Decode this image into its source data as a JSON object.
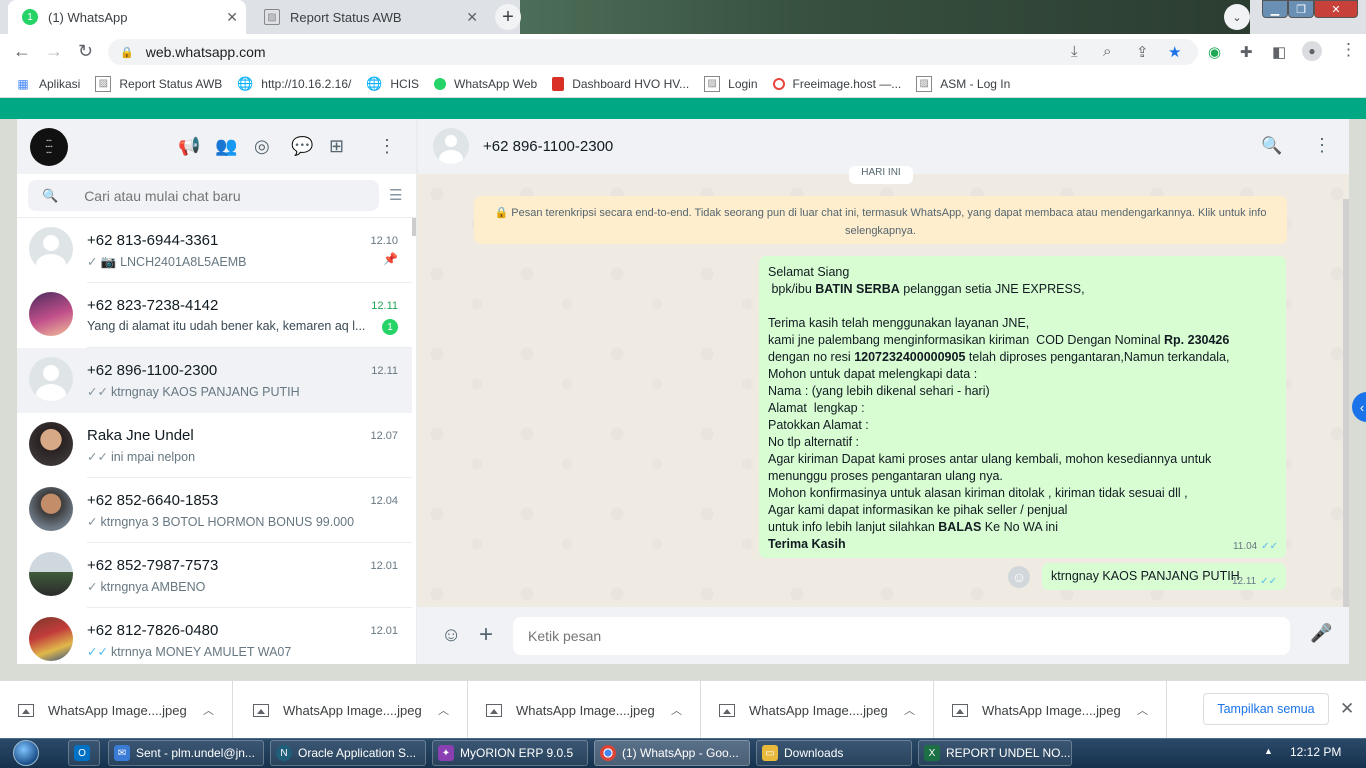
{
  "browser": {
    "tabs": [
      {
        "label": "(1) WhatsApp",
        "badge": "1"
      },
      {
        "label": "Report Status AWB"
      }
    ],
    "url": "web.whatsapp.com",
    "bookmarks": [
      {
        "label": "Aplikasi",
        "icon": "apps-grid-icon"
      },
      {
        "label": "Report Status AWB",
        "icon": "broken-image-icon"
      },
      {
        "label": "http://10.16.2.16/",
        "icon": "globe-icon"
      },
      {
        "label": "HCIS",
        "icon": "globe-icon"
      },
      {
        "label": "WhatsApp Web",
        "icon": "whatsapp-icon"
      },
      {
        "label": "Dashboard HVO HV...",
        "icon": "dashboard-icon"
      },
      {
        "label": "Login",
        "icon": "broken-image-icon"
      },
      {
        "label": "Freeimage.host —...",
        "icon": "freeimage-icon"
      },
      {
        "label": "ASM - Log In",
        "icon": "broken-image-icon"
      }
    ]
  },
  "sidebar": {
    "search_placeholder": "Cari atau mulai chat baru",
    "chats": [
      {
        "name": "+62 813-6944-3361",
        "time": "12.10",
        "preview": "LNCH2401A8L5AEMB",
        "tick": "✓",
        "tick_color": "grey",
        "photo_icon": true,
        "pinned": true
      },
      {
        "name": "+62 823-7238-4142",
        "time": "12.11",
        "preview": "Yang di alamat itu udah bener kak, kemaren aq l...",
        "unread": "1"
      },
      {
        "name": "+62 896-1100-2300",
        "time": "12.11",
        "preview": "ktrngnay KAOS PANJANG PUTIH",
        "tick": "✓✓",
        "tick_color": "grey",
        "active": true
      },
      {
        "name": "Raka Jne Undel",
        "time": "12.07",
        "preview": "ini mpai nelpon",
        "tick": "✓✓",
        "tick_color": "grey"
      },
      {
        "name": "+62 852-6640-1853",
        "time": "12.04",
        "preview": "ktrngnya 3 BOTOL HORMON BONUS 99.000",
        "tick": "✓",
        "tick_color": "grey"
      },
      {
        "name": "+62 852-7987-7573",
        "time": "12.01",
        "preview": "ktrngnya AMBENO",
        "tick": "✓",
        "tick_color": "grey"
      },
      {
        "name": "+62 812-7826-0480",
        "time": "12.01",
        "preview": "ktrnnya MONEY AMULET WA07",
        "tick": "✓✓",
        "tick_color": "blue"
      }
    ]
  },
  "conversation": {
    "contact": "+62 896-1100-2300",
    "date_chip": "HARI INI",
    "encryption_notice": "🔒 Pesan terenkripsi secara end-to-end. Tidak seorang pun di luar chat ini, termasuk WhatsApp, yang dapat membaca atau mendengarkannya. Klik untuk info selengkapnya.",
    "message1": {
      "lines": [
        [
          {
            "t": "Selamat Siang"
          }
        ],
        [
          {
            "t": " bpk/ibu "
          },
          {
            "t": "BATIN SERBA",
            "b": true
          },
          {
            "t": " pelanggan setia JNE EXPRESS,"
          }
        ],
        [
          {
            "t": ""
          }
        ],
        [
          {
            "t": "Terima kasih telah menggunakan layanan JNE,"
          }
        ],
        [
          {
            "t": "kami jne palembang menginformasikan kiriman  COD Dengan Nominal "
          },
          {
            "t": "Rp. 230426",
            "b": true
          }
        ],
        [
          {
            "t": "dengan no resi "
          },
          {
            "t": "1207232400000905",
            "b": true
          },
          {
            "t": " telah diproses pengantaran,Namun terkandala,"
          }
        ],
        [
          {
            "t": "Mohon untuk dapat melengkapi data :"
          }
        ],
        [
          {
            "t": "Nama : (yang lebih dikenal sehari - hari)"
          }
        ],
        [
          {
            "t": "Alamat  lengkap :"
          }
        ],
        [
          {
            "t": "Patokkan Alamat :"
          }
        ],
        [
          {
            "t": "No tlp alternatif :"
          }
        ],
        [
          {
            "t": "Agar kiriman Dapat kami proses antar ulang kembali, mohon kesediannya untuk"
          }
        ],
        [
          {
            "t": "menunggu proses pengantaran ulang nya."
          }
        ],
        [
          {
            "t": "Mohon konfirmasinya untuk alasan kiriman ditolak , kiriman tidak sesuai dll ,"
          }
        ],
        [
          {
            "t": "Agar kami dapat informasikan ke pihak seller / penjual"
          }
        ],
        [
          {
            "t": "untuk info lebih lanjut silahkan "
          },
          {
            "t": "BALAS",
            "b": true
          },
          {
            "t": " Ke No WA ini"
          }
        ],
        [
          {
            "t": "Terima Kasih",
            "b": true
          }
        ]
      ],
      "time": "11.04",
      "ticks": "✓✓"
    },
    "message2": {
      "text": "ktrngnay KAOS PANJANG PUTIH",
      "time": "12.11",
      "ticks": "✓✓"
    },
    "composer_placeholder": "Ketik pesan"
  },
  "downloads": {
    "items": [
      "WhatsApp Image....jpeg",
      "WhatsApp Image....jpeg",
      "WhatsApp Image....jpeg",
      "WhatsApp Image....jpeg",
      "WhatsApp Image....jpeg"
    ],
    "show_all": "Tampilkan semua"
  },
  "taskbar": {
    "items": [
      {
        "label": "",
        "icon": "outlook-icon",
        "color": "#0072c6"
      },
      {
        "label": "Sent - plm.undel@jn...",
        "icon": "mail-icon",
        "color": "#3a7bd5"
      },
      {
        "label": "Oracle Application S...",
        "icon": "oracle-icon",
        "color": "#1f5f7a"
      },
      {
        "label": "MyORION ERP 9.0.5",
        "icon": "orion-icon",
        "color": "#8a3fb3"
      },
      {
        "label": "(1) WhatsApp - Goo...",
        "icon": "chrome-icon",
        "color": "#db4437"
      },
      {
        "label": "Downloads",
        "icon": "folder-icon",
        "color": "#e8b93b"
      },
      {
        "label": "REPORT UNDEL NO...",
        "icon": "excel-icon",
        "color": "#1d7044"
      }
    ],
    "clock": "12:12 PM"
  },
  "colors": {
    "accent": "#00a884",
    "bubble_out": "#d9fdd3",
    "tick_read": "#53bdeb"
  }
}
